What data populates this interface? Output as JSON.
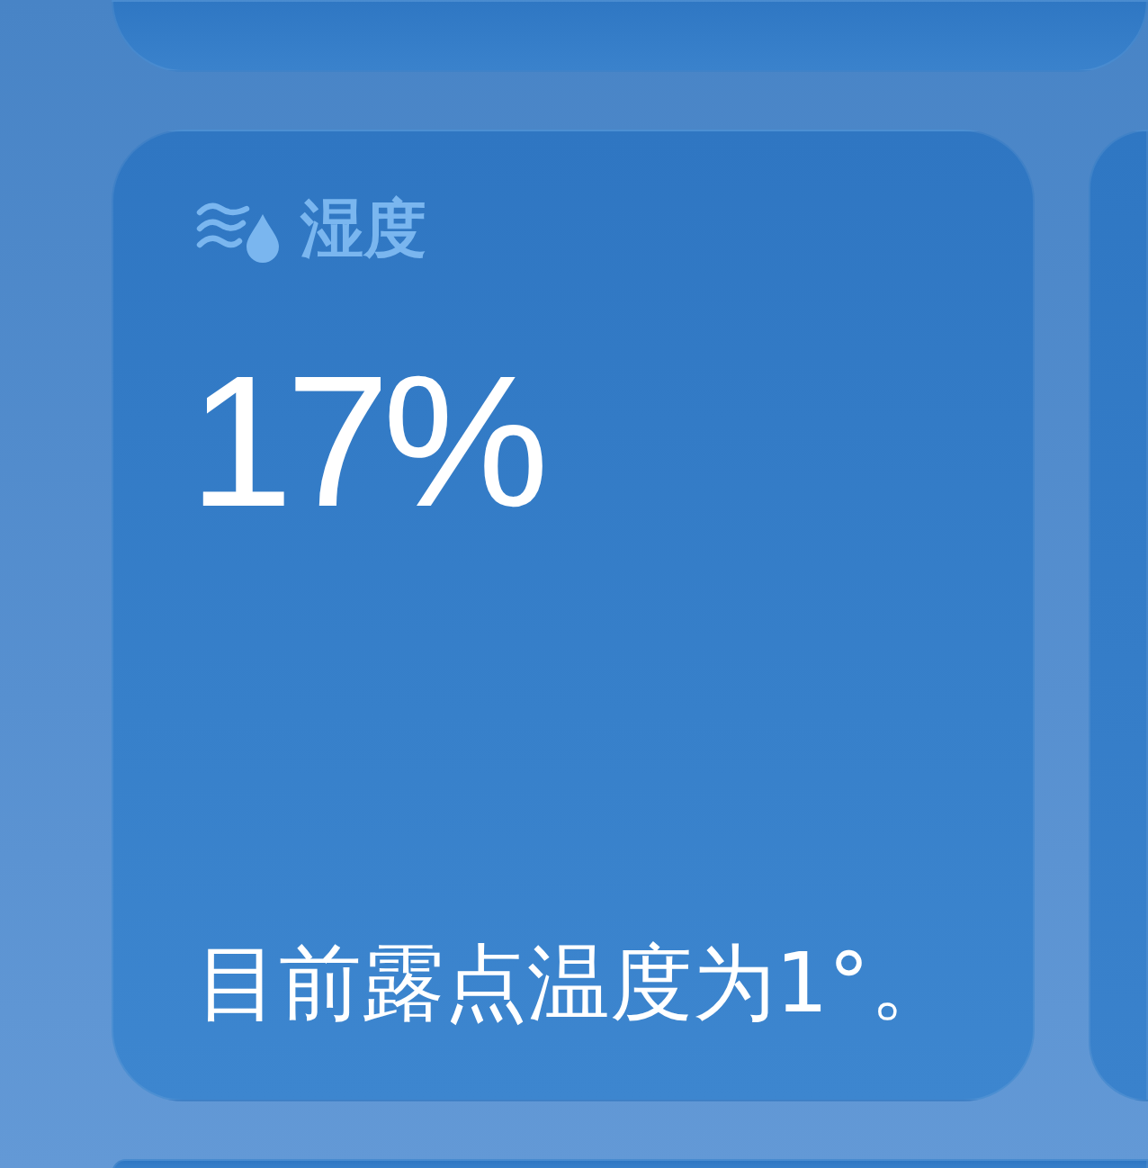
{
  "humidity_card": {
    "title": "湿度",
    "value": "17%",
    "description": "目前露点温度为1°。"
  }
}
